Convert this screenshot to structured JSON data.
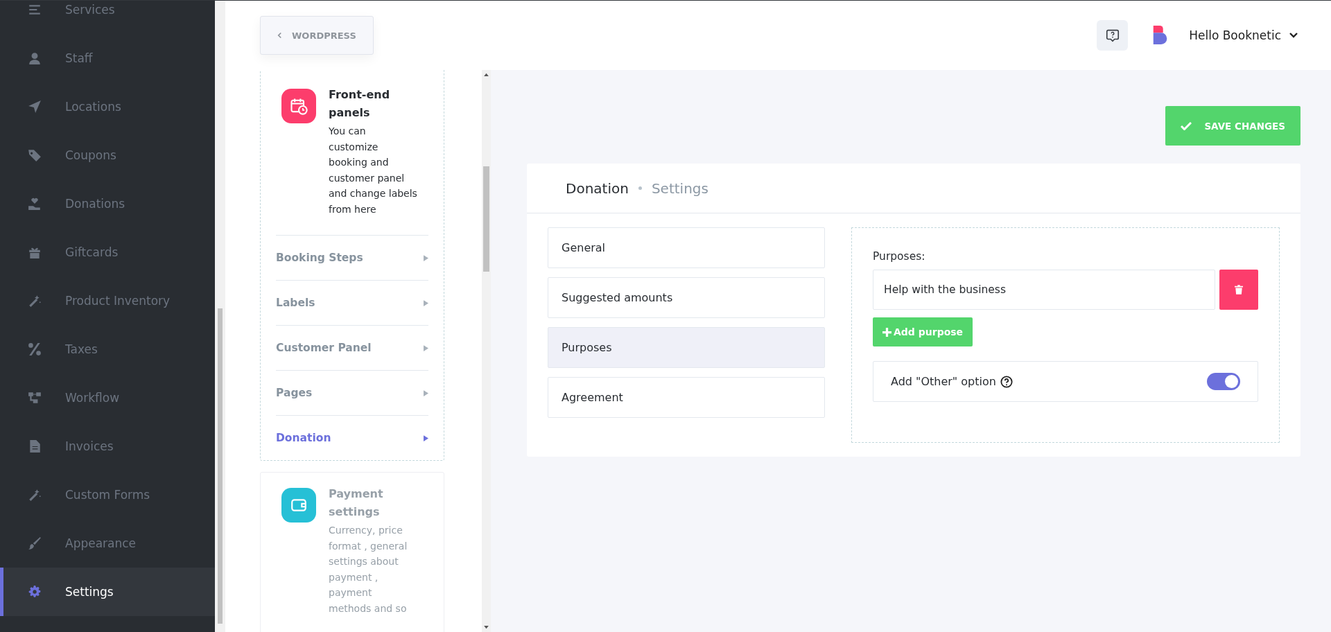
{
  "sidebar": {
    "items": [
      {
        "label": "Services",
        "selected": false
      },
      {
        "label": "Staff",
        "selected": false
      },
      {
        "label": "Locations",
        "selected": false
      },
      {
        "label": "Coupons",
        "selected": false
      },
      {
        "label": "Donations",
        "selected": false
      },
      {
        "label": "Giftcards",
        "selected": false
      },
      {
        "label": "Product Inventory",
        "selected": false
      },
      {
        "label": "Taxes",
        "selected": false
      },
      {
        "label": "Workflow",
        "selected": false
      },
      {
        "label": "Invoices",
        "selected": false
      },
      {
        "label": "Custom Forms",
        "selected": false
      },
      {
        "label": "Appearance",
        "selected": false
      },
      {
        "label": "Settings",
        "selected": true
      }
    ]
  },
  "header": {
    "back_button": "WORDPRESS",
    "user_name": "Hello Booknetic"
  },
  "settings_nav": {
    "cards": [
      {
        "title": "Front-end panels",
        "description": "You can customize booking and customer panel and change labels from here",
        "selected": true,
        "items": [
          {
            "label": "Booking Steps",
            "selected": false
          },
          {
            "label": "Labels",
            "selected": false
          },
          {
            "label": "Customer Panel",
            "selected": false
          },
          {
            "label": "Pages",
            "selected": false
          },
          {
            "label": "Donation",
            "selected": true
          }
        ]
      },
      {
        "title": "Payment settings",
        "description": "Currency, price format , general settings about payment , payment methods and so",
        "selected": false
      }
    ]
  },
  "main": {
    "save_button": "SAVE CHANGES",
    "title": "Donation",
    "subtitle": "Settings",
    "tabs": [
      {
        "label": "General",
        "selected": false
      },
      {
        "label": "Suggested amounts",
        "selected": false
      },
      {
        "label": "Purposes",
        "selected": true
      },
      {
        "label": "Agreement",
        "selected": false
      }
    ],
    "purposes_label": "Purposes:",
    "purposes": [
      {
        "value": "Help with the business"
      }
    ],
    "add_button": "Add purpose",
    "other_option": {
      "label": "Add \"Other\" option",
      "on": true
    }
  }
}
